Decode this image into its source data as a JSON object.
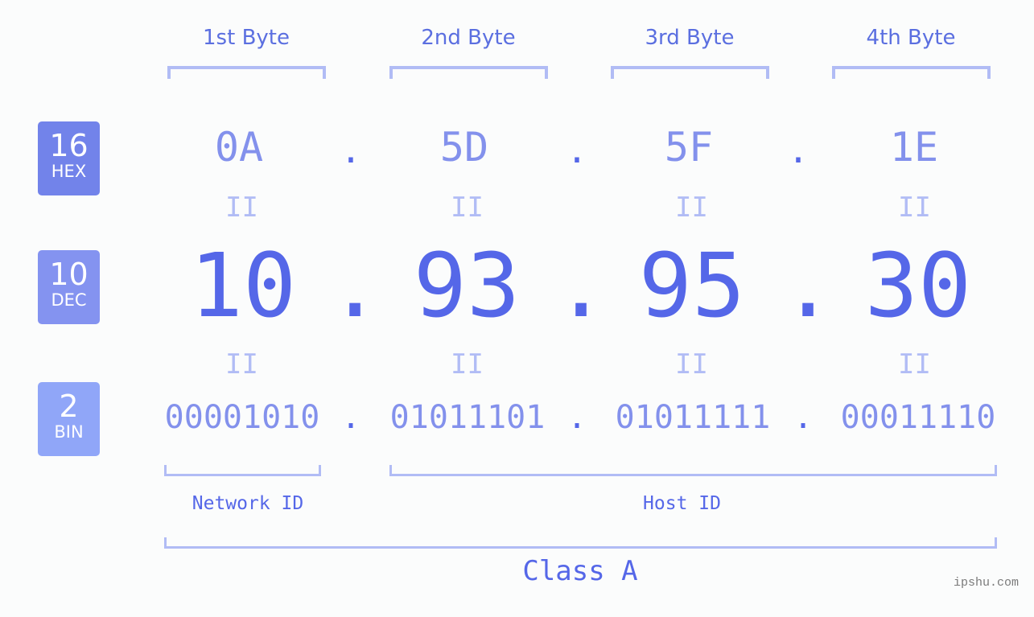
{
  "bytes": [
    {
      "label": "1st Byte",
      "hex": "0A",
      "dec": "10",
      "bin": "00001010"
    },
    {
      "label": "2nd Byte",
      "hex": "5D",
      "dec": "93",
      "bin": "01011101"
    },
    {
      "label": "3rd Byte",
      "hex": "5F",
      "dec": "95",
      "bin": "01011111"
    },
    {
      "label": "4th Byte",
      "hex": "1E",
      "dec": "30",
      "bin": "00011110"
    }
  ],
  "separator": ".",
  "equals": "II",
  "badges": {
    "hex": {
      "num": "16",
      "label": "HEX",
      "color": "#7283ea"
    },
    "dec": {
      "num": "10",
      "label": "DEC",
      "color": "#8493f0"
    },
    "bin": {
      "num": "2",
      "label": "BIN",
      "color": "#90a6f8"
    }
  },
  "network_id": "Network ID",
  "host_id": "Host ID",
  "ip_class": "Class A",
  "watermark": "ipshu.com",
  "colors": {
    "primary": "#5567e8",
    "light": "#8391ec",
    "bracket": "#b1bcf5"
  }
}
